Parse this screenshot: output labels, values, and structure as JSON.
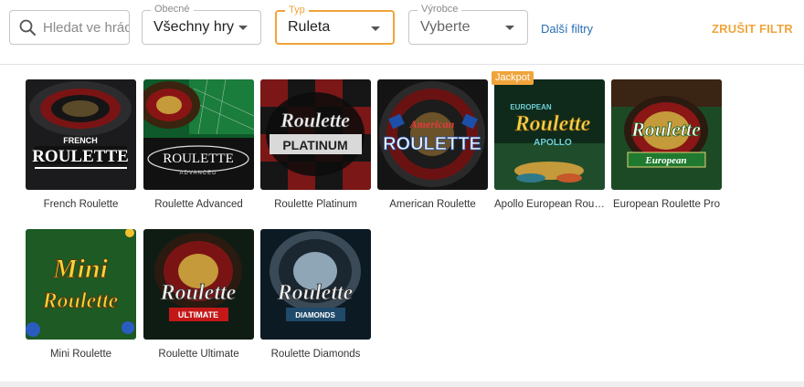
{
  "search": {
    "placeholder": "Hledat ve hrách"
  },
  "filters": {
    "general": {
      "label": "Obecné",
      "value": "Všechny hry"
    },
    "type": {
      "label": "Typ",
      "value": "Ruleta"
    },
    "provider": {
      "label": "Výrobce",
      "value": "Vyberte"
    },
    "more_label": "Další filtry",
    "clear_label": "ZRUŠIT FILTR"
  },
  "badges": {
    "jackpot": "Jackpot"
  },
  "games": [
    {
      "name": "French Roulette",
      "logo_top": "FRENCH",
      "logo_main": "ROULETTE",
      "logo_sub": ""
    },
    {
      "name": "Roulette Advanced",
      "logo_top": "",
      "logo_main": "ROULETTE",
      "logo_sub": "ADVANCED"
    },
    {
      "name": "Roulette Platinum",
      "logo_top": "Roulette",
      "logo_main": "PLATINUM",
      "logo_sub": ""
    },
    {
      "name": "American Roulette",
      "logo_top": "American",
      "logo_main": "ROULETTE",
      "logo_sub": ""
    },
    {
      "name": "Apollo European Roulette",
      "logo_top": "EUROPEAN",
      "logo_main": "Roulette",
      "logo_sub": "APOLLO"
    },
    {
      "name": "European Roulette Pro",
      "logo_top": "",
      "logo_main": "Roulette",
      "logo_sub": "European"
    },
    {
      "name": "Mini Roulette",
      "logo_top": "Mini",
      "logo_main": "Roulette",
      "logo_sub": ""
    },
    {
      "name": "Roulette Ultimate",
      "logo_top": "",
      "logo_main": "Roulette",
      "logo_sub": "ULTIMATE"
    },
    {
      "name": "Roulette Diamonds",
      "logo_top": "",
      "logo_main": "Roulette",
      "logo_sub": "DIAMONDS"
    }
  ],
  "colors": {
    "accent": "#f0a43a",
    "link": "#2a6db3",
    "border": "#c6c6c6"
  }
}
